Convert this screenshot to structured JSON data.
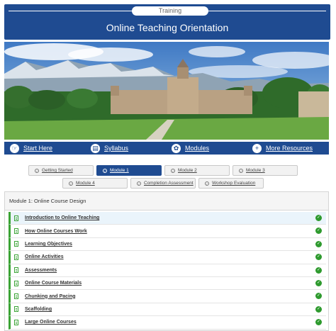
{
  "header": {
    "badge": "Training",
    "title": "Online Teaching Orientation"
  },
  "hero": {
    "alt": "Campus building with mountains"
  },
  "nav": [
    {
      "label": "Start Here",
      "icon": "hand-pointer-icon"
    },
    {
      "label": "Syllabus",
      "icon": "syllabus-icon"
    },
    {
      "label": "Modules",
      "icon": "modules-icon"
    },
    {
      "label": "More Resources",
      "icon": "plus-icon"
    }
  ],
  "tabs": [
    {
      "label": "Getting Started",
      "active": false
    },
    {
      "label": "Module 1",
      "active": true
    },
    {
      "label": "Module 2",
      "active": false
    },
    {
      "label": "Module 3",
      "active": false
    },
    {
      "label": "Module 4",
      "active": false
    },
    {
      "label": "Completion Assessment",
      "active": false
    },
    {
      "label": "Workshop Evaluation",
      "active": false
    }
  ],
  "module": {
    "title": "Module 1: Online Course Design",
    "items": [
      {
        "label": "Introduction to Online Teaching",
        "completed": true
      },
      {
        "label": "How Online Courses Work",
        "completed": true
      },
      {
        "label": "Learning Objectives",
        "completed": true
      },
      {
        "label": "Online Activities",
        "completed": true
      },
      {
        "label": "Assessments",
        "completed": true
      },
      {
        "label": "Online Course Materials",
        "completed": true
      },
      {
        "label": "Chunking and Pacing",
        "completed": true
      },
      {
        "label": "Scaffolding",
        "completed": true
      },
      {
        "label": "Large Online Courses",
        "completed": true
      }
    ]
  },
  "colors": {
    "brand": "#1f4b91",
    "complete": "#2e9a2e"
  }
}
